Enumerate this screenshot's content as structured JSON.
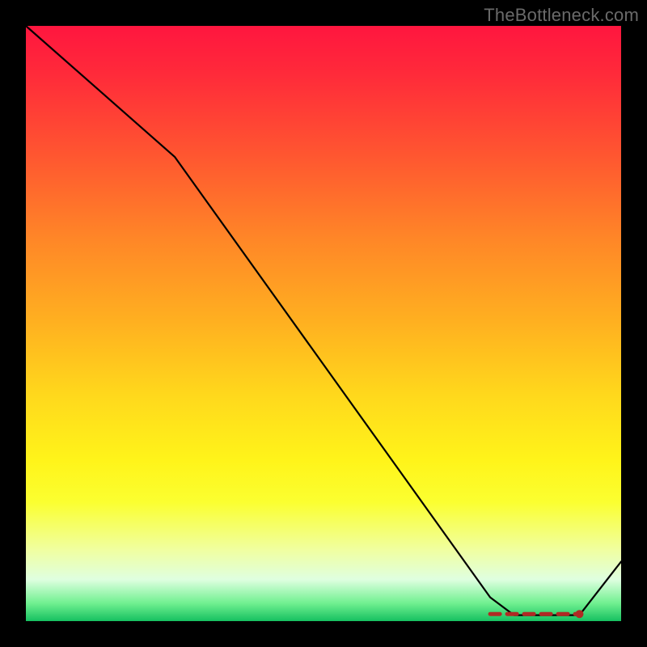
{
  "watermark": "TheBottleneck.com",
  "chart_data": {
    "type": "line",
    "title": "",
    "xlabel": "",
    "ylabel": "",
    "xlim": [
      0,
      100
    ],
    "ylim": [
      0,
      100
    ],
    "series": [
      {
        "name": "bottleneck-curve",
        "x": [
          0,
          25,
          78,
          82,
          93,
          100
        ],
        "values": [
          100,
          78,
          4,
          1,
          1,
          10
        ]
      }
    ],
    "annotations": [
      {
        "name": "optimal-range-dash",
        "x_start": 78,
        "x_end": 93,
        "y": 1.2,
        "color": "#b02a24"
      }
    ],
    "background_gradient": {
      "top": "#ff163f",
      "mid": "#ffe81a",
      "bottom": "#16c060"
    }
  }
}
